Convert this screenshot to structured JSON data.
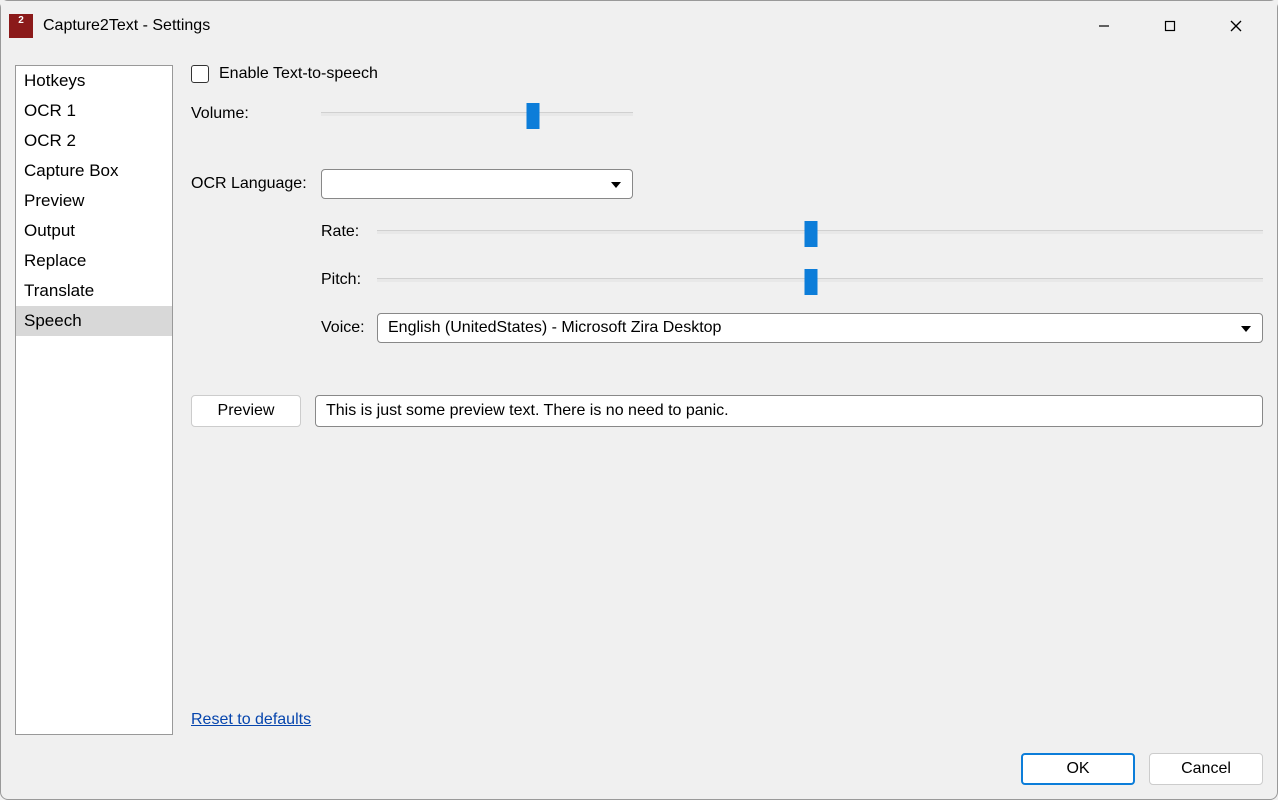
{
  "window": {
    "title": "Capture2Text - Settings"
  },
  "sidebar": {
    "items": [
      {
        "label": "Hotkeys"
      },
      {
        "label": "OCR 1"
      },
      {
        "label": "OCR 2"
      },
      {
        "label": "Capture Box"
      },
      {
        "label": "Preview"
      },
      {
        "label": "Output"
      },
      {
        "label": "Replace"
      },
      {
        "label": "Translate"
      },
      {
        "label": "Speech",
        "selected": true
      }
    ]
  },
  "speech": {
    "enable_label": "Enable Text-to-speech",
    "enable_checked": false,
    "volume_label": "Volume:",
    "volume_pct": 68,
    "ocr_lang_label": "OCR Language:",
    "ocr_lang_value": "",
    "rate_label": "Rate:",
    "rate_pct": 49,
    "pitch_label": "Pitch:",
    "pitch_pct": 49,
    "voice_label": "Voice:",
    "voice_value": "English (UnitedStates) - Microsoft Zira Desktop",
    "preview_button": "Preview",
    "preview_text": "This is just some preview text. There is no need to panic.",
    "reset_link": "Reset to defaults"
  },
  "footer": {
    "ok": "OK",
    "cancel": "Cancel"
  }
}
